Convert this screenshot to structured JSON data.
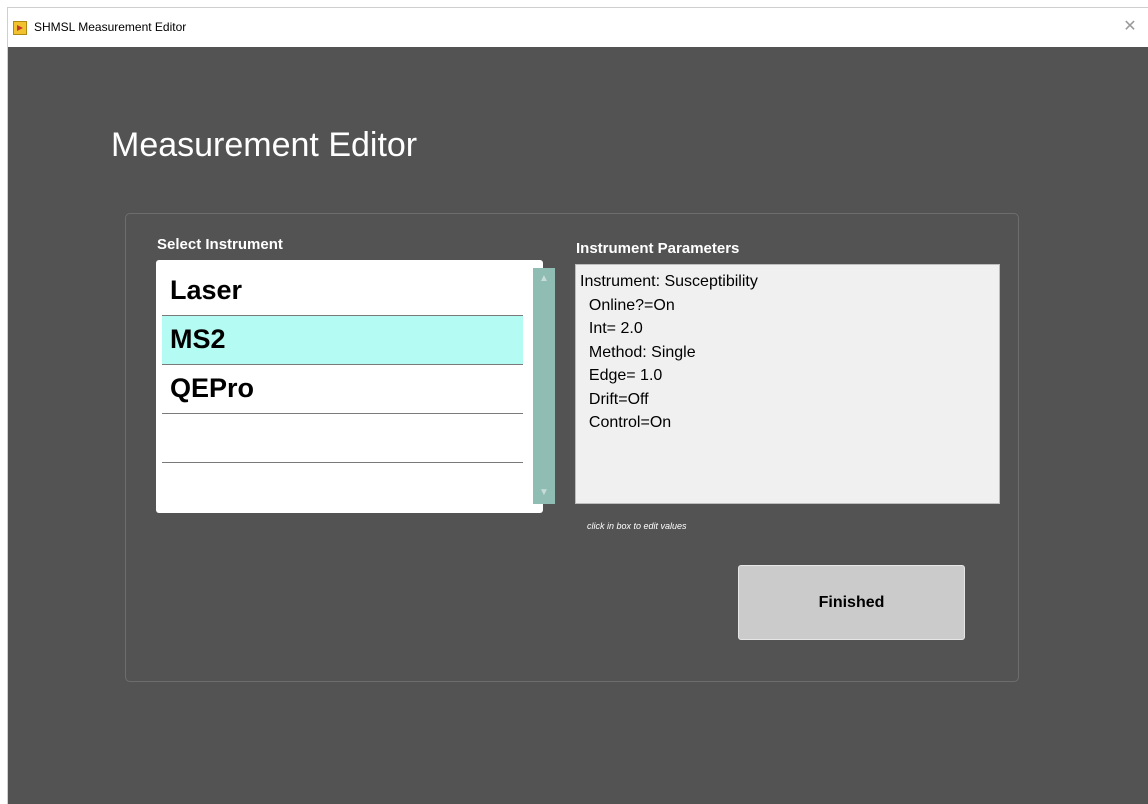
{
  "window": {
    "title": "SHMSL Measurement Editor",
    "close_glyph": "✕"
  },
  "heading": "Measurement Editor",
  "select_instrument": {
    "label": "Select Instrument",
    "items": [
      "Laser",
      "MS2",
      "QEPro",
      "",
      ""
    ],
    "selected": "MS2"
  },
  "instrument_parameters": {
    "label": "Instrument Parameters",
    "lines": [
      "Instrument: Susceptibility",
      "  Online?=On",
      "  Int= 2.0",
      "  Method: Single",
      "  Edge= 1.0",
      "  Drift=Off",
      "  Control=On"
    ],
    "hint": "click in box to edit values"
  },
  "finished_button": {
    "label": "Finished"
  },
  "colors": {
    "background": "#535353",
    "selected_row": "#b3fbf3",
    "scrollbar": "#8fbdb3",
    "button": "#cbcbcb"
  }
}
